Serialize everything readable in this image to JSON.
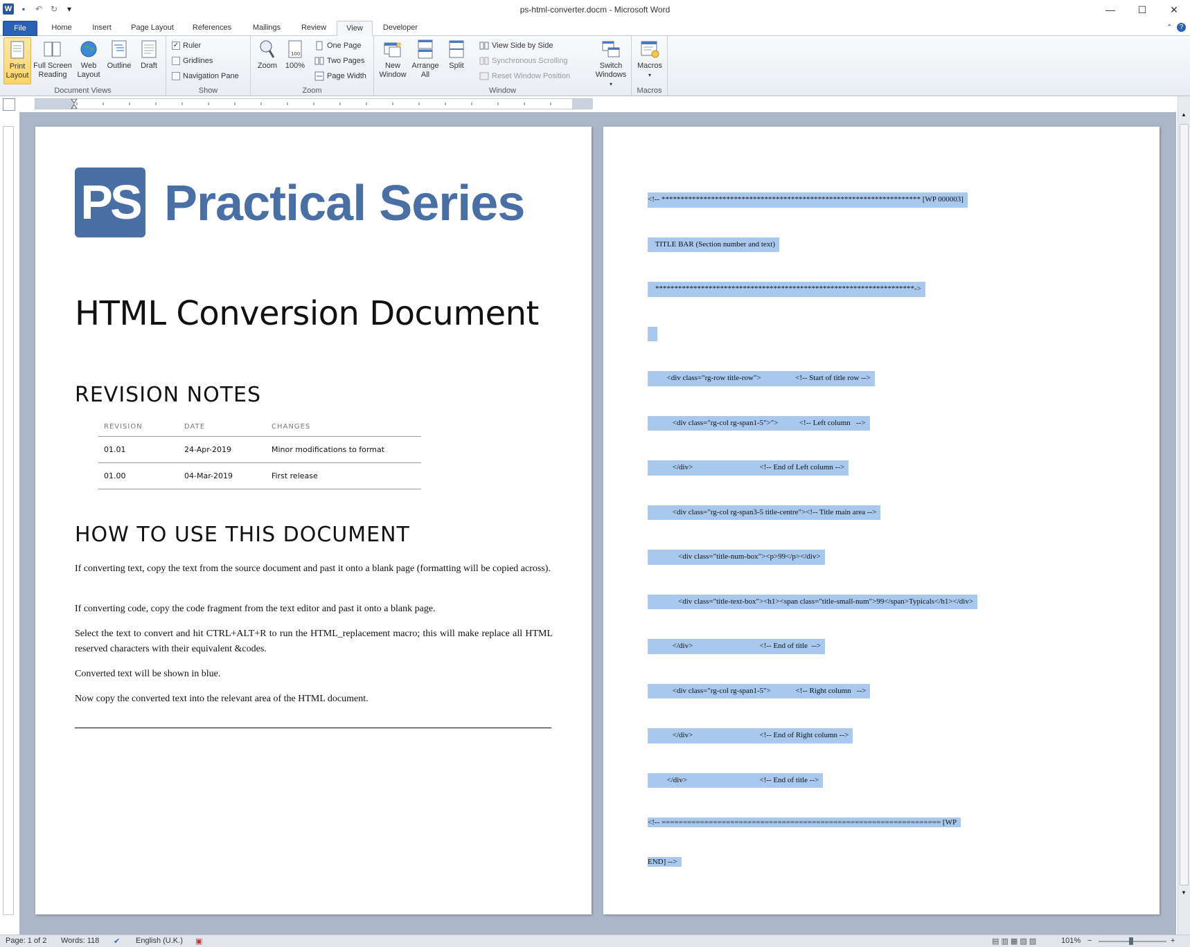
{
  "window": {
    "title": "ps-html-converter.docm - Microsoft Word",
    "minimize": "—",
    "maximize": "☐",
    "close": "✕"
  },
  "qat": {
    "app_icon": "W",
    "save_icon": "▪",
    "undo_icon": "↶",
    "redo_icon": "↻",
    "customize_icon": "▾"
  },
  "tabs": [
    {
      "label": "File"
    },
    {
      "label": "Home"
    },
    {
      "label": "Insert"
    },
    {
      "label": "Page Layout"
    },
    {
      "label": "References"
    },
    {
      "label": "Mailings"
    },
    {
      "label": "Review"
    },
    {
      "label": "View"
    },
    {
      "label": "Developer"
    }
  ],
  "tabright": {
    "minimize_ribbon": "⌃",
    "help": "?"
  },
  "ribbon": {
    "document_views": {
      "label": "Document Views",
      "print_layout": "Print Layout",
      "full_screen_reading": "Full Screen Reading",
      "web_layout": "Web Layout",
      "outline": "Outline",
      "draft": "Draft"
    },
    "show": {
      "label": "Show",
      "ruler": "Ruler",
      "ruler_checked": "✓",
      "gridlines": "Gridlines",
      "navigation_pane": "Navigation Pane"
    },
    "zoom": {
      "label": "Zoom",
      "zoom": "Zoom",
      "hundred": "100%",
      "one_page": "One Page",
      "two_pages": "Two Pages",
      "page_width": "Page Width"
    },
    "window": {
      "label": "Window",
      "new_window": "New Window",
      "arrange_all": "Arrange All",
      "split": "Split",
      "view_side_by_side": "View Side by Side",
      "synchronous_scrolling": "Synchronous Scrolling",
      "reset_window_position": "Reset Window Position",
      "switch_windows": "Switch Windows"
    },
    "macros": {
      "label": "Macros",
      "macros": "Macros"
    }
  },
  "page1": {
    "logo_mark": "PS",
    "logo_text": "Practical Series",
    "title": "HTML Conversion Document",
    "revision_heading": "REVISION NOTES",
    "table_headers": [
      "REVISION",
      "DATE",
      "CHANGES"
    ],
    "table_rows": [
      [
        "01.01",
        "24-Apr-2019",
        "Minor modifications to format"
      ],
      [
        "01.00",
        "04-Mar-2019",
        "First release"
      ]
    ],
    "howto_heading": "HOW TO USE THIS DOCUMENT",
    "paragraphs": [
      "If converting text, copy the text from the source document and past it onto a blank page (formatting will be copied across).",
      "If converting code, copy the code fragment from the text editor and past it onto a blank page.",
      "Select the text to convert and hit CTRL+ALT+R to run the HTML_replacement macro; this will make replace all HTML reserved characters with their equivalent &codes.",
      "Converted text will be shown in blue.",
      "Now copy the converted text into the relevant area of the HTML document."
    ]
  },
  "page2": {
    "code_lines": [
      "<!-- ******************************************************************** [WP 000003]",
      "    TITLE BAR (Section number and text)",
      "    ********************************************************************->",
      "",
      "          <div class=\"rg-row title-row\">                  <!-- Start of title row -->",
      "             <div class=\"rg-col rg-span1-5\">\">           <!-- Left column   -->",
      "             </div>                                   <!-- End of Left column -->",
      "             <div class=\"rg-col rg-span3-5 title-centre\"><!-- Title main area -->",
      "                <div class=\"title-num-box\"><p>99</p></div>",
      "                <div class=\"title-text-box\"><h1><span class=\"title-small-num\">99</span>Typicals</h1></div>",
      "             </div>                                   <!-- End of title  -->",
      "             <div class=\"rg-col rg-span1-5\">             <!-- Right column   -->",
      "             </div>                                   <!-- End of Right column -->",
      "          </div>                                      <!-- End of title -->",
      "<!-- ================================================================= [WP",
      "END] -->"
    ]
  },
  "status": {
    "page": "Page: 1 of 2",
    "words": "Words: 118",
    "language": "English (U.K.)",
    "zoom": "101%",
    "zoom_out": "−",
    "zoom_in": "+"
  }
}
